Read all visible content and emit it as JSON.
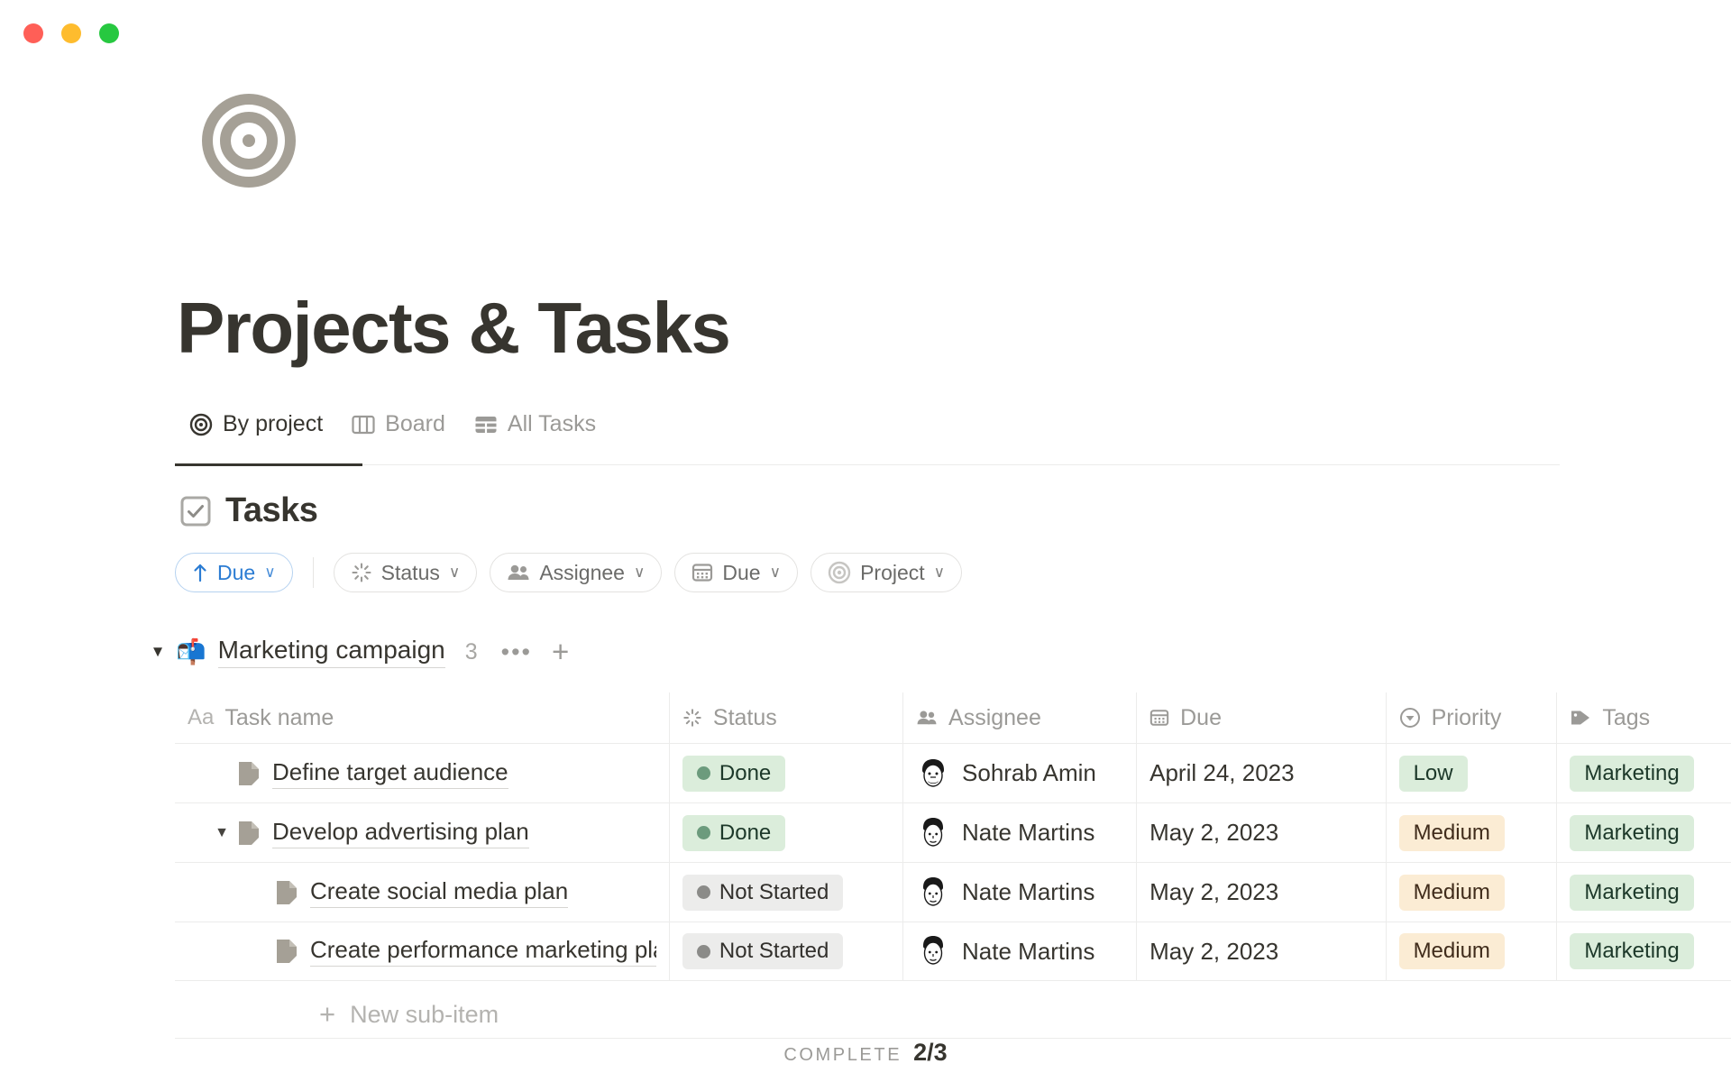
{
  "window": {
    "controls": [
      {
        "name": "close",
        "color": "#ff5f57"
      },
      {
        "name": "minimize",
        "color": "#febc2e"
      },
      {
        "name": "maximize",
        "color": "#27c840"
      }
    ]
  },
  "page": {
    "icon": "target-icon",
    "title": "Projects & Tasks"
  },
  "tabs": [
    {
      "label": "By project",
      "icon": "target-icon",
      "active": true
    },
    {
      "label": "Board",
      "icon": "board-columns-icon",
      "active": false
    },
    {
      "label": "All Tasks",
      "icon": "table-icon",
      "active": false
    }
  ],
  "section": {
    "icon": "checkbox-checked-icon",
    "title": "Tasks"
  },
  "filters": {
    "sort": {
      "label": "Due",
      "icon": "arrow-up-icon",
      "chevron": "∨",
      "color": "#2b7cd3"
    },
    "items": [
      {
        "label": "Status",
        "icon": "spinner-icon",
        "chevron": "∨"
      },
      {
        "label": "Assignee",
        "icon": "people-icon",
        "chevron": "∨"
      },
      {
        "label": "Due",
        "icon": "calendar-icon",
        "chevron": "∨"
      },
      {
        "label": "Project",
        "icon": "target-icon",
        "chevron": "∨"
      }
    ]
  },
  "group": {
    "toggle": "▼",
    "emoji": "📬",
    "name": "Marketing campaign",
    "count": "3",
    "more": "•••",
    "add": "+"
  },
  "table": {
    "columns": [
      {
        "label": "Task name",
        "icon": "text-aa-icon"
      },
      {
        "label": "Status",
        "icon": "spinner-icon"
      },
      {
        "label": "Assignee",
        "icon": "people-icon"
      },
      {
        "label": "Due",
        "icon": "calendar-icon"
      },
      {
        "label": "Priority",
        "icon": "priority-circle-icon"
      },
      {
        "label": "Tags",
        "icon": "tag-icon"
      }
    ],
    "rows": [
      {
        "name": "Define target audience",
        "status": "Done",
        "status_kind": "done",
        "assignee": "Sohrab Amin",
        "avatar": "sohrab-avatar",
        "due": "April 24, 2023",
        "priority": "Low",
        "priority_kind": "low",
        "tag": "Marketing",
        "indent": 0,
        "expandable": false
      },
      {
        "name": "Develop advertising plan",
        "status": "Done",
        "status_kind": "done",
        "assignee": "Nate Martins",
        "avatar": "nate-avatar",
        "due": "May 2, 2023",
        "priority": "Medium",
        "priority_kind": "medium",
        "tag": "Marketing",
        "indent": 0,
        "expandable": true,
        "expanded": "▼"
      },
      {
        "name": "Create social media plan",
        "status": "Not Started",
        "status_kind": "notstarted",
        "assignee": "Nate Martins",
        "avatar": "nate-avatar",
        "due": "May 2, 2023",
        "priority": "Medium",
        "priority_kind": "medium",
        "tag": "Marketing",
        "indent": 1,
        "expandable": false
      },
      {
        "name": "Create performance marketing plan",
        "status": "Not Started",
        "status_kind": "notstarted",
        "assignee": "Nate Martins",
        "avatar": "nate-avatar",
        "due": "May 2, 2023",
        "priority": "Medium",
        "priority_kind": "medium",
        "tag": "Marketing",
        "indent": 1,
        "expandable": false
      }
    ],
    "new_subitem": {
      "label": "New sub-item",
      "icon": "plus-icon"
    }
  },
  "footer": {
    "label": "COMPLETE",
    "value": "2/3"
  },
  "colors": {
    "accent": "#2b7cd3",
    "text": "#37352f",
    "muted": "#9b9a97",
    "green_bg": "#dbeddb",
    "amber_bg": "#fbecd4",
    "grey_bg": "#ececeb"
  }
}
